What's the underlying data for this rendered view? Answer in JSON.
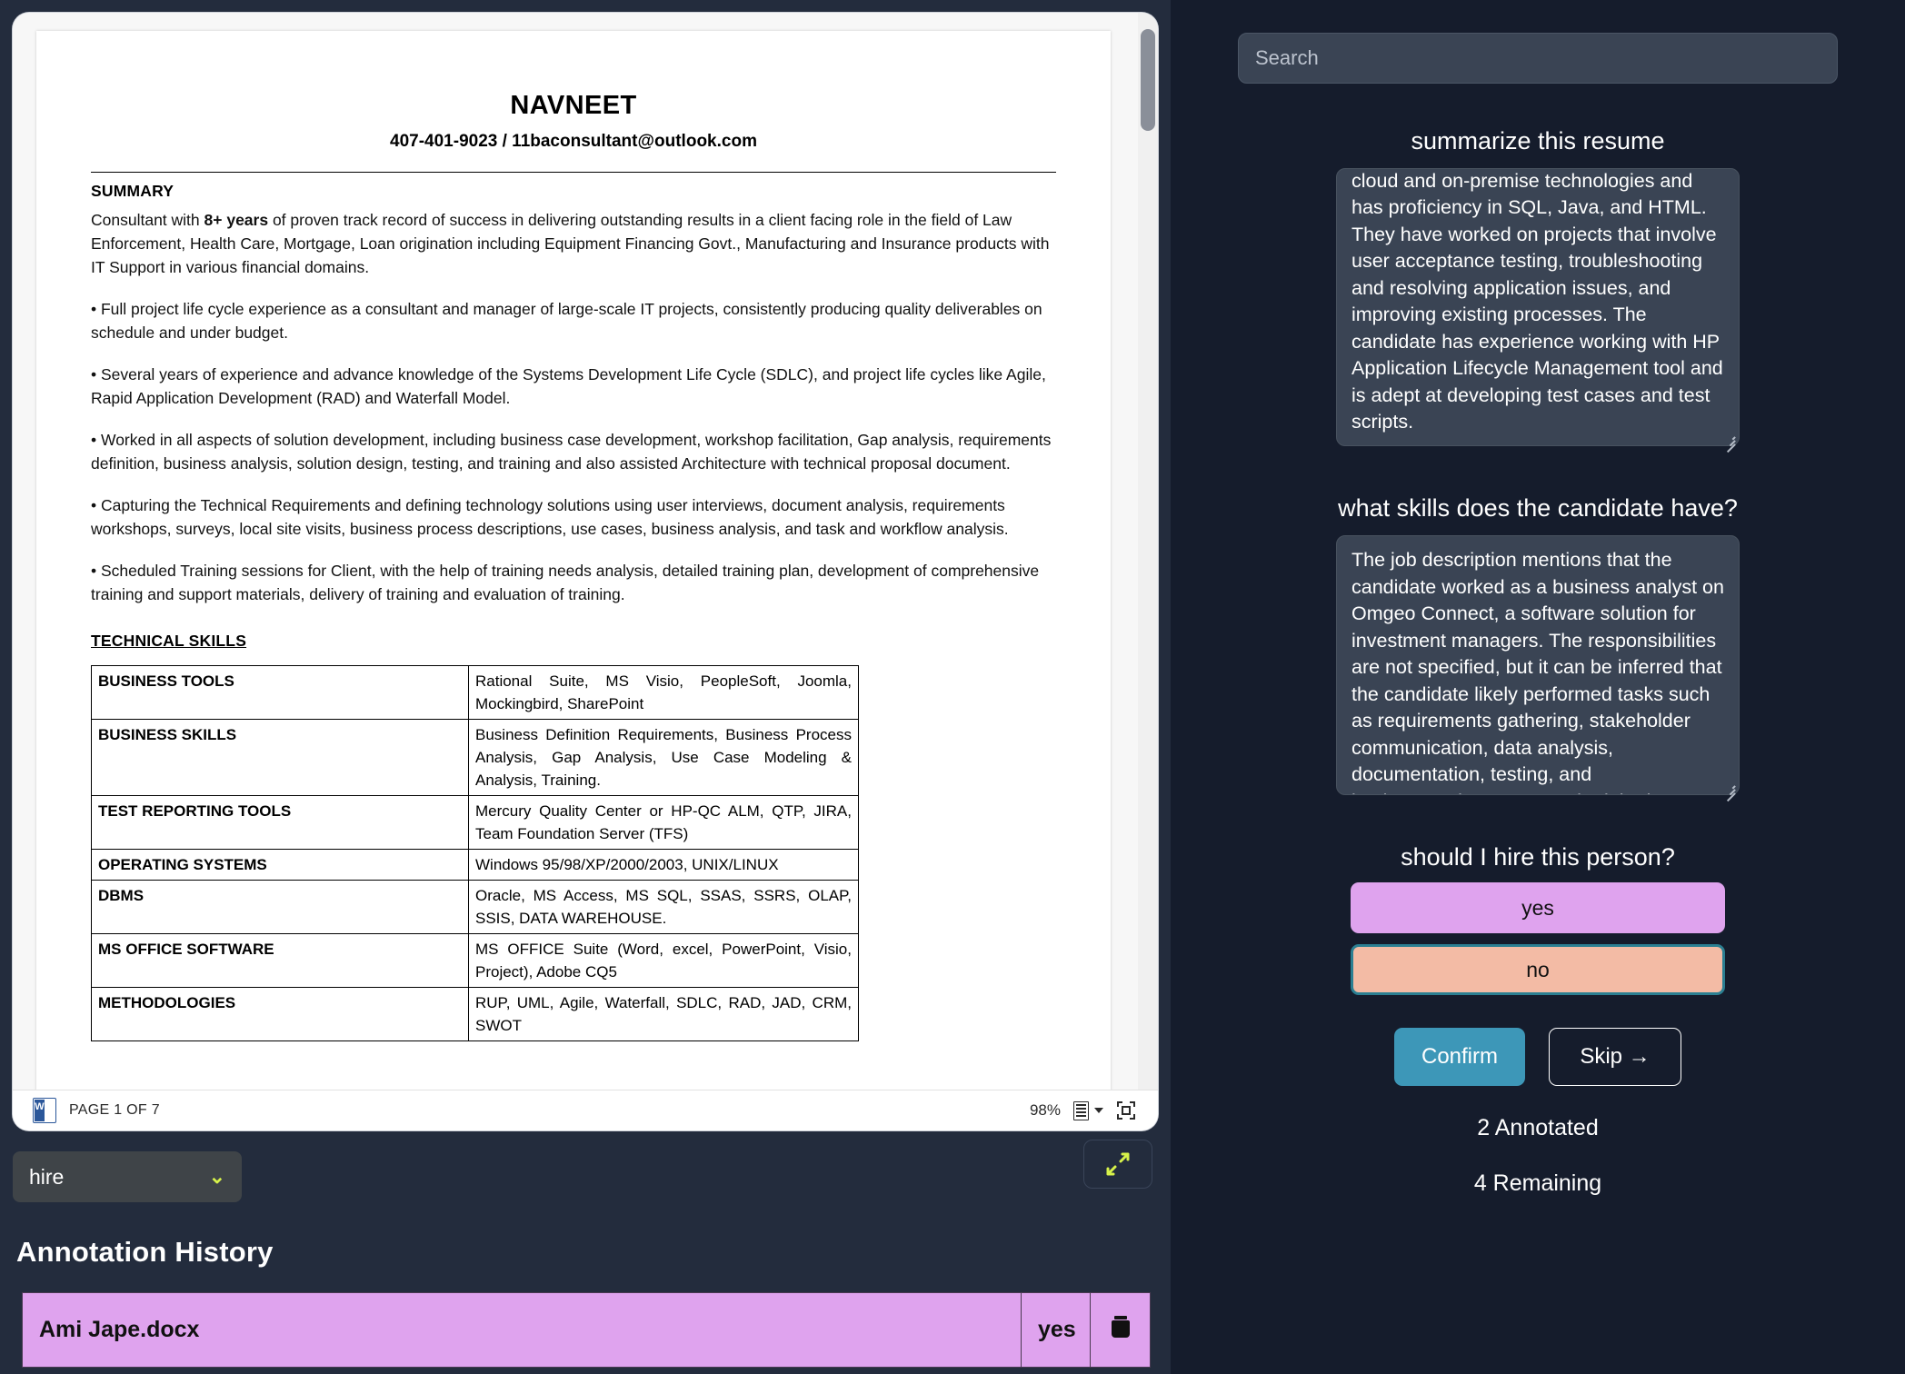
{
  "document": {
    "name": "NAVNEET",
    "contact": "407-401-9023 / 11baconsultant@outlook.com",
    "summary_heading": "SUMMARY",
    "summary_intro_a": "Consultant with ",
    "summary_intro_b": "8+ years",
    "summary_intro_c": " of proven track record of success in delivering outstanding results in a client facing role in the field of Law Enforcement, Health Care, Mortgage, Loan origination including Equipment Financing Govt., Manufacturing and Insurance products with IT Support in various financial domains.",
    "bullets": [
      "• Full project life cycle experience as a consultant and manager of large-scale IT projects, consistently producing quality deliverables on schedule and under budget.",
      "• Several years of experience and advance knowledge of the Systems Development Life Cycle (SDLC), and project life cycles like Agile, Rapid Application Development (RAD) and Waterfall Model.",
      "• Worked in all aspects of solution development, including business case development, workshop facilitation, Gap analysis, requirements definition, business analysis, solution design, testing, and training and also assisted Architecture with technical proposal document.",
      "• Capturing the Technical Requirements and defining technology solutions using user interviews, document analysis, requirements workshops, surveys, local site visits, business process descriptions, use cases, business analysis, and task and workflow analysis.",
      "• Scheduled Training sessions for Client, with the help of training needs analysis, detailed training plan, development of comprehensive training and support materials, delivery of training and evaluation of training."
    ],
    "skills_heading": "TECHNICAL SKILLS",
    "skills_rows": [
      {
        "key": "BUSINESS TOOLS",
        "value": "Rational Suite, MS Visio, PeopleSoft, Joomla, Mockingbird, SharePoint"
      },
      {
        "key": "BUSINESS SKILLS",
        "value": "Business Definition Requirements, Business Process Analysis, Gap Analysis, Use Case Modeling & Analysis, Training."
      },
      {
        "key": "TEST REPORTING TOOLS",
        "value": "Mercury Quality Center or HP-QC ALM, QTP, JIRA, Team Foundation Server (TFS)"
      },
      {
        "key": "OPERATING SYSTEMS",
        "value": "Windows 95/98/XP/2000/2003, UNIX/LINUX"
      },
      {
        "key": "DBMS",
        "value": "Oracle, MS Access, MS SQL, SSAS, SSRS, OLAP, SSIS, DATA WAREHOUSE."
      },
      {
        "key": "MS OFFICE SOFTWARE",
        "value": "MS OFFICE Suite (Word, excel, PowerPoint, Visio, Project), Adobe CQ5"
      },
      {
        "key": "METHODOLOGIES",
        "value": "RUP, UML, Agile, Waterfall, SDLC, RAD, JAD, CRM, SWOT"
      }
    ]
  },
  "pdf_toolbar": {
    "file_icon": "word-doc-icon",
    "page_label": "PAGE 1 OF 7",
    "zoom": "98%",
    "layout_icon": "page-layout-icon",
    "caret_icon": "chevron-down-icon",
    "fit_icon": "fit-to-screen-icon"
  },
  "controls": {
    "label_select_value": "hire",
    "label_select_chevron": "chevron-down-icon",
    "expand_icon": "expand-arrows-icon"
  },
  "annotation_history": {
    "title": "Annotation History",
    "rows": [
      {
        "filename": "Ami Jape.docx",
        "value": "yes",
        "delete_icon": "trash-icon"
      }
    ]
  },
  "search": {
    "placeholder": "Search",
    "value": ""
  },
  "questions": [
    {
      "prompt": "summarize this resume",
      "answer": "skilled in application development, change management, and quality assurance. The candidate has experience working with cloud and on-premise technologies and has proficiency in SQL, Java, and HTML. They have worked on projects that involve user acceptance testing, troubleshooting and resolving application issues, and improving existing processes. The candidate has experience working with HP Application Lifecycle Management tool and is adept at developing test cases and test scripts."
    },
    {
      "prompt": "what skills does the candidate have?",
      "answer": "The job description mentions that the candidate worked as a business analyst on Omgeo Connect, a software solution for investment managers. The responsibilities are not specified, but it can be inferred that the candidate likely performed tasks such as requirements gathering, stakeholder communication, data analysis, documentation, testing, and implementation support. The job also required the candidate to work as a team player, which suggests that they have good"
    }
  ],
  "hire_question": {
    "prompt": "should I hire this person?",
    "options": [
      {
        "label": "yes",
        "color": "#dfa3ee",
        "selected": false
      },
      {
        "label": "no",
        "color": "#f3bba5",
        "selected": true
      }
    ]
  },
  "actions": {
    "confirm_label": "Confirm",
    "skip_label": "Skip →",
    "confirm_color": "#3d97b8"
  },
  "stats": {
    "annotated": "2 Annotated",
    "remaining": "4 Remaining"
  }
}
